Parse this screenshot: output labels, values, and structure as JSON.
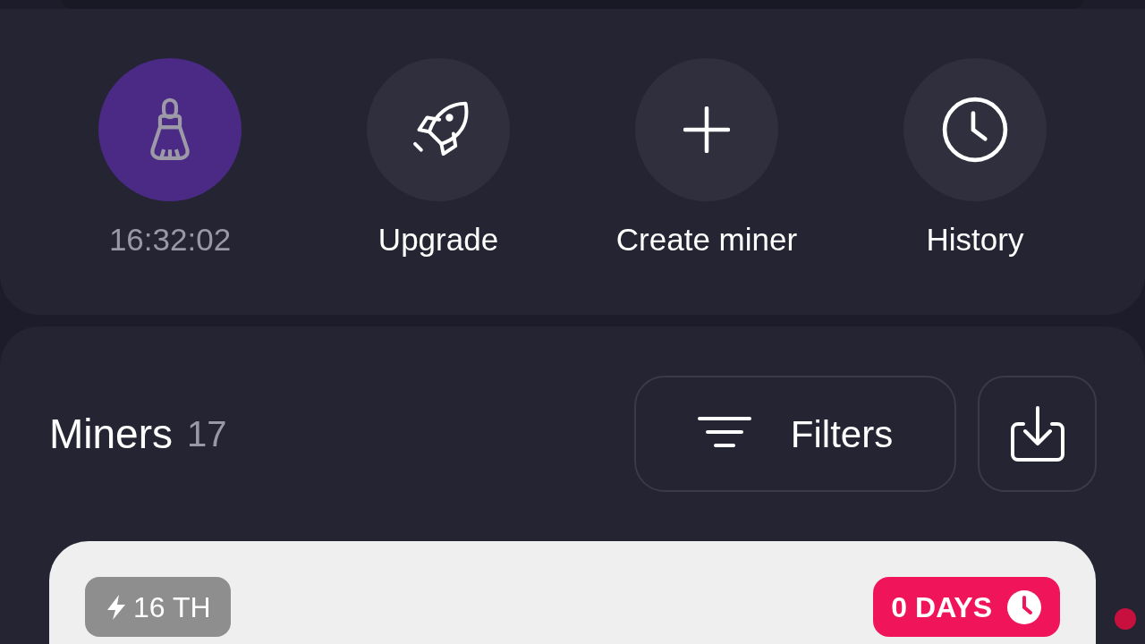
{
  "actions": [
    {
      "kind": "cooldown",
      "label": "16:32:02"
    },
    {
      "kind": "action",
      "label": "Upgrade"
    },
    {
      "kind": "action",
      "label": "Create miner"
    },
    {
      "kind": "action",
      "label": "History"
    }
  ],
  "miners": {
    "title": "Miners",
    "count": "17",
    "filters_label": "Filters",
    "card": {
      "hashrate": "16 TH",
      "expiry": "0 DAYS"
    }
  }
}
